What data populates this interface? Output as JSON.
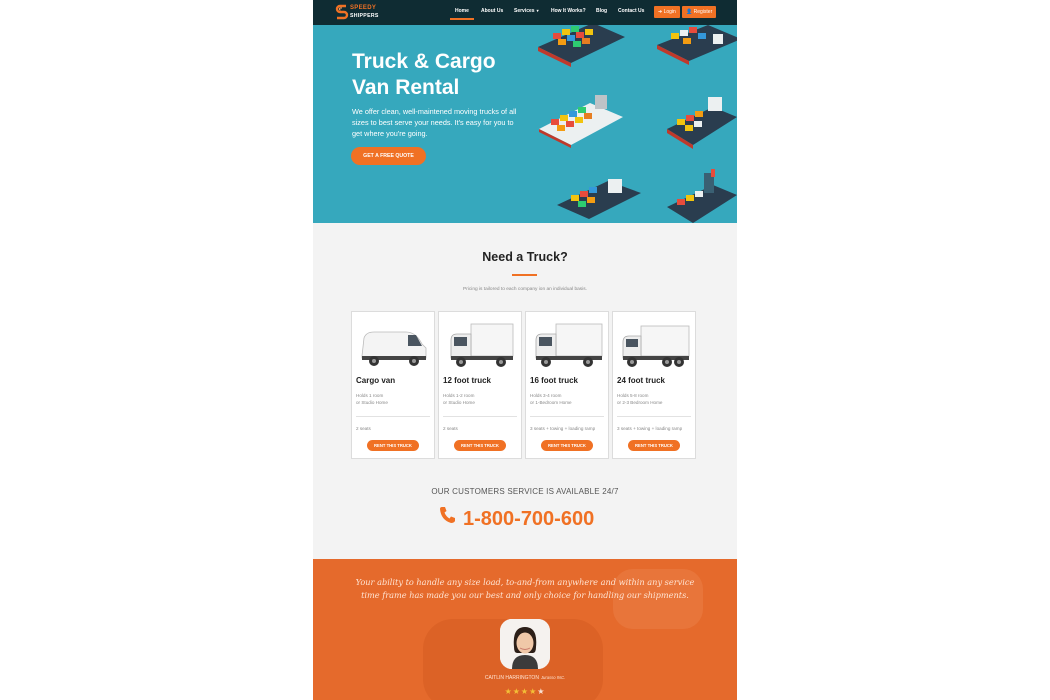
{
  "colors": {
    "accent": "#f07124",
    "nav_bg": "#0f2c33",
    "hero_bg": "#36a8bd",
    "section_bg": "#f3f3f3",
    "testimonial_bg": "#e56a2c"
  },
  "brand": {
    "logo_icon": "ss-logo-icon",
    "line1": "SPEEDY",
    "line2": "SHIPPERS"
  },
  "nav": {
    "items": [
      {
        "label": "Home",
        "active": true
      },
      {
        "label": "About Us"
      },
      {
        "label": "Services",
        "has_dropdown": true
      },
      {
        "label": "How It Works?"
      },
      {
        "label": "Blog"
      },
      {
        "label": "Contact Us"
      }
    ],
    "login_label": "Login",
    "register_label": "Register"
  },
  "hero": {
    "title": "Truck & Cargo Van Rental",
    "text": "We offer clean, well-maintened moving trucks of all sizes to best serve your needs. It's easy for you to get where you're going.",
    "button": "GET A FREE QUOTE"
  },
  "trucks": {
    "title": "Need a Truck?",
    "subtitle": "Pricing is tailored to each company ion an individual basis.",
    "cards": [
      {
        "name": "Cargo van",
        "desc1": "Holds 1 room",
        "desc2": "or Studio Home",
        "features": "2 seats",
        "button": "RENT THIS TRUCK"
      },
      {
        "name": "12 foot truck",
        "desc1": "Holds 1-2 room",
        "desc2": "or Studio Home",
        "features": "2 seats",
        "button": "RENT THIS TRUCK"
      },
      {
        "name": "16 foot truck",
        "desc1": "Holds 3-4 room",
        "desc2": "or 1-Bedroom Home",
        "features": "3 seats + towing + loading ramp",
        "button": "RENT THIS TRUCK"
      },
      {
        "name": "24 foot truck",
        "desc1": "Holds 5-8 room",
        "desc2": "or 2-3 Bedroom Home",
        "features": "3 seats + towing + loading ramp",
        "button": "RENT THIS TRUCK"
      }
    ]
  },
  "support": {
    "availability": "OUR CUSTOMERS SERVICE IS AVAILABLE 24/7",
    "phone": "1-800-700-600"
  },
  "testimonial": {
    "quote": "Your ability to handle any size load, to-and-from anywhere and within any service time frame has made you our best and only choice for handling our shipments.",
    "name": "CAITLIN HARRINGTON",
    "company": "Jurasso INC.",
    "rating": 4,
    "max_rating": 5
  }
}
